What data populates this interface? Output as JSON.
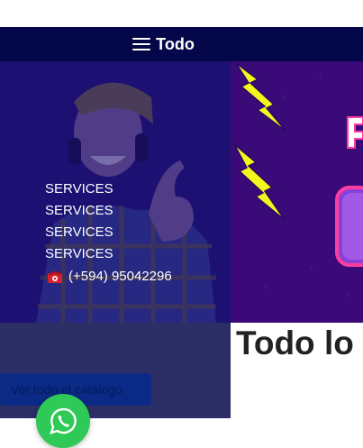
{
  "navbar": {
    "label": "Todo",
    "menu_icon": "hamburger-icon"
  },
  "hero": {
    "services": [
      "SERVICES",
      "SERVICES",
      "SERVICES",
      "SERVICES"
    ],
    "phone": "(+594) 95042296",
    "phone_icon": "telephone-icon"
  },
  "catalog_button": "Ver todo el catálogo",
  "section_title": "Todo lo",
  "whatsapp_icon": "whatsapp-icon",
  "colors": {
    "navbar": "#04074a",
    "hero_overlay": "#1d1470",
    "graphic_bg": "#3a0a78",
    "bolt": "#f5f51e",
    "whatsapp": "#2fc957"
  }
}
